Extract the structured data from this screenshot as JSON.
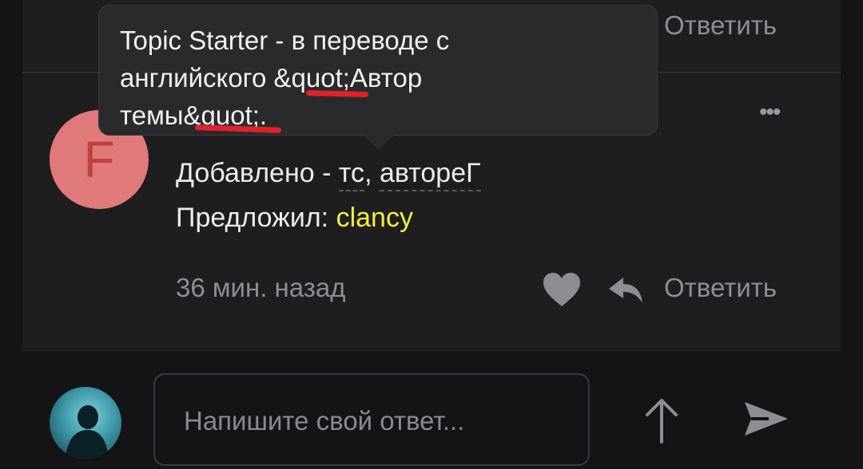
{
  "colors": {
    "background": "#141416",
    "panel": "#1e1e20",
    "tooltip": "#2a2a2c",
    "username": "#f2ee3c",
    "avatar_bg": "#e07a7a",
    "avatar_letter": "#c04040",
    "annotation": "#e2212b"
  },
  "previous_comment": {
    "reply_label": "Ответить"
  },
  "tooltip": {
    "line1": "Topic Starter - в переводе с",
    "line2": "английского &quot;Автор",
    "line3": "темы&quot;."
  },
  "comment": {
    "avatar_letter": "F",
    "more_icon": "more-dots-icon",
    "body_prefix": "Добавлено - ",
    "body_term": "тс",
    "body_separator": ", ",
    "body_term2": "автореГ",
    "suggested_label": "Предложил: ",
    "suggested_user": "clancy",
    "time": "36 мин. назад",
    "like_icon": "heart-icon",
    "reply_icon": "reply-arrow-icon",
    "reply_label": "Ответить"
  },
  "composer": {
    "placeholder": "Напишите свой ответ...",
    "value": "",
    "scroll_icon": "arrow-up-icon",
    "send_icon": "send-icon"
  }
}
